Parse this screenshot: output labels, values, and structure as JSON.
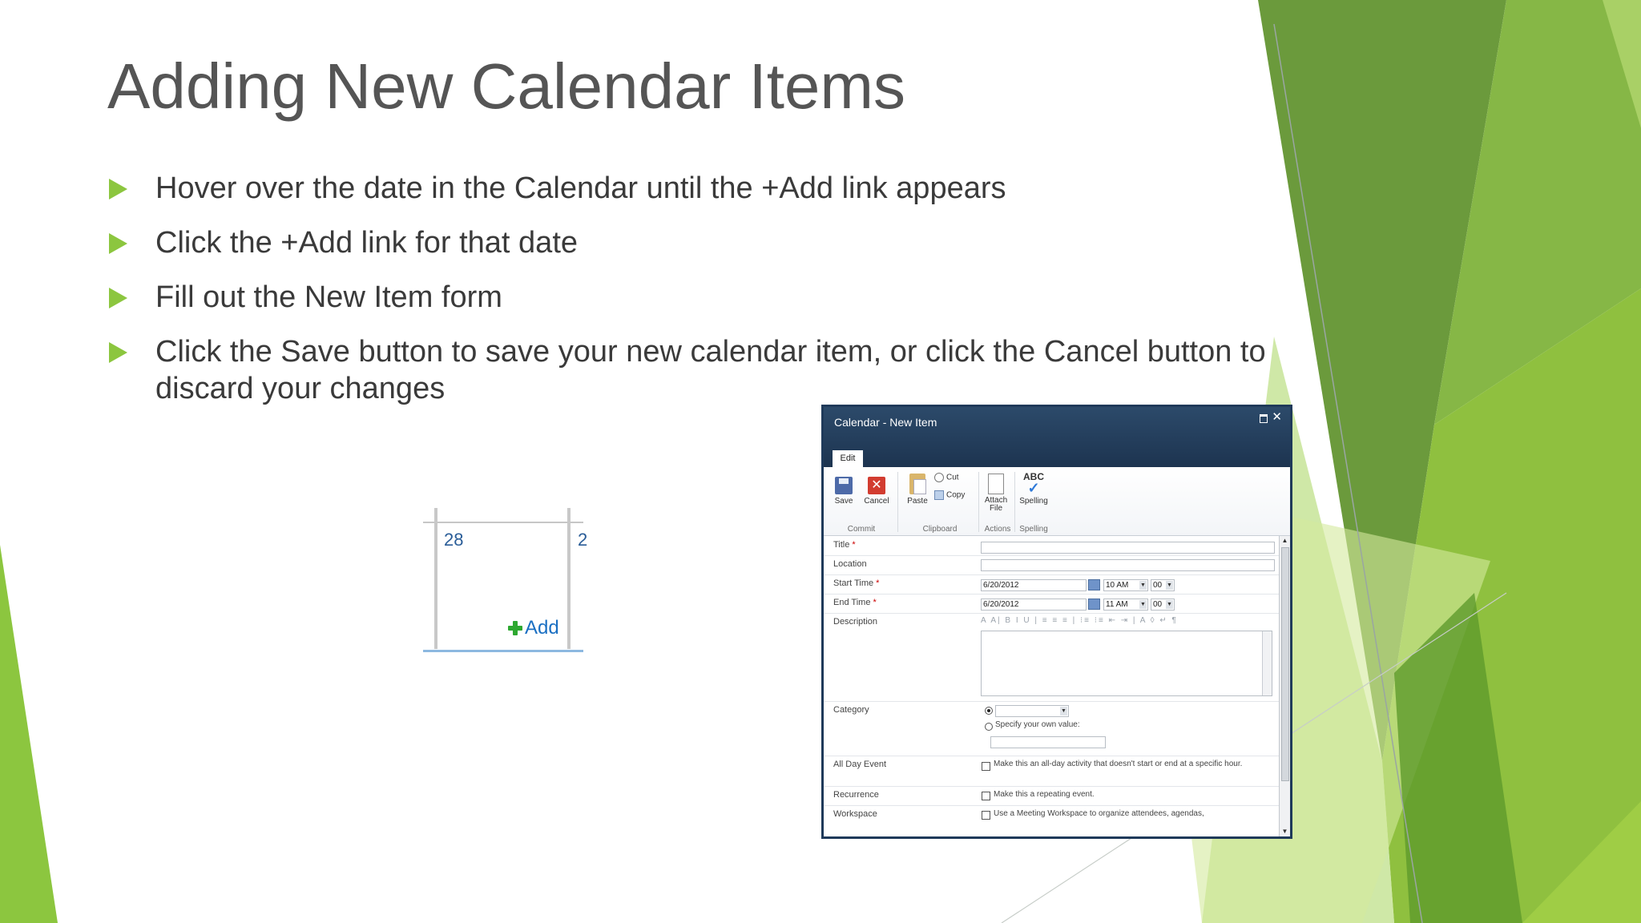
{
  "slide": {
    "title": "Adding New Calendar Items",
    "bullets": [
      "Hover over the date in the Calendar until the +Add link appears",
      "Click the +Add link for that date",
      "Fill out the New Item form",
      "Click the Save button to save your new calendar item, or click the Cancel button to discard your changes"
    ]
  },
  "calendar_snippet": {
    "day": "28",
    "next_day_partial": "2",
    "add_label": "Add"
  },
  "dialog": {
    "title": "Calendar - New Item",
    "tab": "Edit",
    "ribbon": {
      "save": "Save",
      "cancel": "Cancel",
      "paste": "Paste",
      "cut": "Cut",
      "copy": "Copy",
      "attach_file": "Attach File",
      "spelling": "Spelling",
      "spell_glyph": "ABC",
      "groups": {
        "commit": "Commit",
        "clipboard": "Clipboard",
        "actions": "Actions",
        "spelling": "Spelling"
      }
    },
    "form": {
      "title_label": "Title",
      "location_label": "Location",
      "start_label": "Start Time",
      "start_date": "6/20/2012",
      "start_hour": "10 AM",
      "start_min": "00",
      "end_label": "End Time",
      "end_date": "6/20/2012",
      "end_hour": "11 AM",
      "end_min": "00",
      "description_label": "Description",
      "rte_toolbar": "A A| B I U | ≡ ≡ ≡ | ⁝≡ ⁝≡ ⇤ ⇥ | A ◊ ↵ ¶",
      "category_label": "Category",
      "category_custom": "Specify your own value:",
      "allday_label": "All Day Event",
      "allday_text": "Make this an all-day activity that doesn't start or end at a specific hour.",
      "recurrence_label": "Recurrence",
      "recurrence_text": "Make this a repeating event.",
      "workspace_label": "Workspace",
      "workspace_text": "Use a Meeting Workspace to organize attendees, agendas,"
    }
  },
  "colors": {
    "accent_green": "#8cc63f",
    "title_gray": "#555555",
    "dialog_header": "#1d3450"
  }
}
